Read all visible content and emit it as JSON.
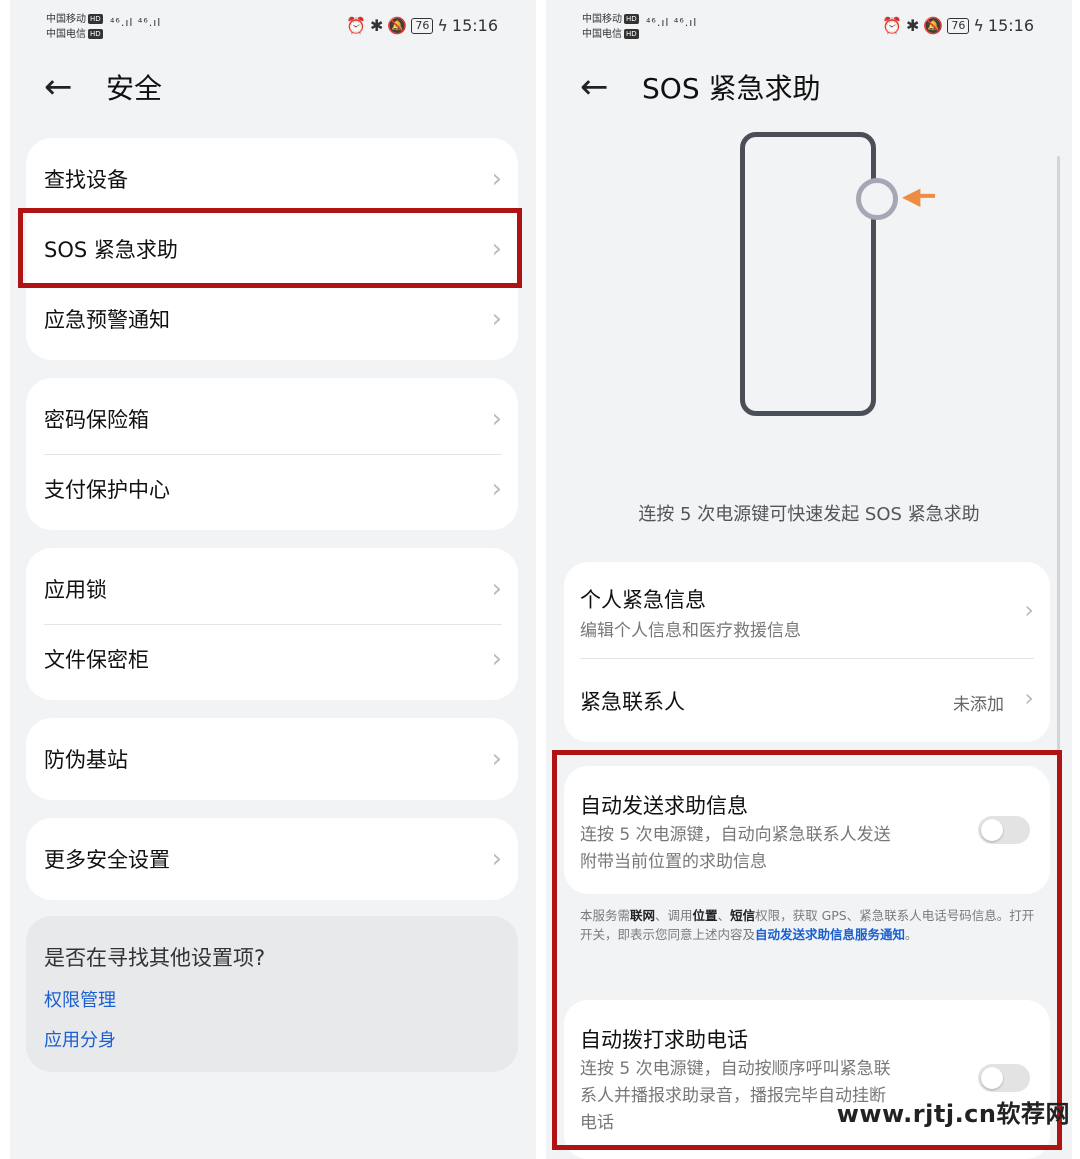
{
  "left": {
    "status": {
      "carrier1": "中国移动",
      "carrier2": "中国电信",
      "hd": "HD",
      "signal": "⁴⁶.ıl ⁴⁶.ıl",
      "battery": "76",
      "time": "15:16"
    },
    "header": {
      "title": "安全"
    },
    "groups": [
      {
        "items": [
          {
            "label": "查找设备"
          },
          {
            "label": "SOS 紧急求助"
          },
          {
            "label": "应急预警通知"
          }
        ]
      },
      {
        "items": [
          {
            "label": "密码保险箱"
          },
          {
            "label": "支付保护中心"
          }
        ]
      },
      {
        "items": [
          {
            "label": "应用锁"
          },
          {
            "label": "文件保密柜"
          }
        ]
      },
      {
        "items": [
          {
            "label": "防伪基站"
          }
        ]
      },
      {
        "items": [
          {
            "label": "更多安全设置"
          }
        ]
      }
    ],
    "suggest": {
      "title": "是否在寻找其他设置项?",
      "links": [
        "权限管理",
        "应用分身"
      ]
    }
  },
  "right": {
    "status": {
      "carrier1": "中国移动",
      "carrier2": "中国电信",
      "hd": "HD",
      "signal": "⁴⁶.ıl ⁴⁶.ıl",
      "battery": "76",
      "time": "15:16"
    },
    "header": {
      "title": "SOS 紧急求助"
    },
    "caption": "连按 5 次电源键可快速发起 SOS 紧急求助",
    "personal": {
      "title": "个人紧急信息",
      "subtitle": "编辑个人信息和医疗救援信息"
    },
    "contact": {
      "title": "紧急联系人",
      "value": "未添加"
    },
    "auto_message": {
      "title": "自动发送求助信息",
      "desc_line1": "连按 5 次电源键，自动向紧急联系人发送",
      "desc_line2": "附带当前位置的求助信息",
      "enabled": false
    },
    "notice": {
      "p1": "本服务需",
      "b1": "联网",
      "p2": "、调用",
      "b2": "位置",
      "p3": "、",
      "b3": "短信",
      "p4": "权限，获取 GPS、紧急联系人电话号码信息。打开开关，即表示您同意上述内容及",
      "link": "自动发送求助信息服务通知",
      "p5": "。"
    },
    "auto_call": {
      "title": "自动拨打求助电话",
      "desc_line1": "连按 5 次电源键，自动按顺序呼叫紧急联",
      "desc_line2": "系人并播报求助录音，播报完毕自动挂断",
      "desc_line3": "电话",
      "enabled": false
    }
  },
  "watermark": "www.rjtj.cn软荐网",
  "colors": {
    "highlight": "#b01313",
    "link": "#1a5fd0",
    "accent": "#ef8c43",
    "background": "#f1f3f5"
  },
  "icons": {
    "back": "arrow-left-icon",
    "chevron": "chevron-right-icon",
    "alarm": "alarm-icon",
    "bluetooth": "bluetooth-icon",
    "mute": "bell-off-icon"
  }
}
